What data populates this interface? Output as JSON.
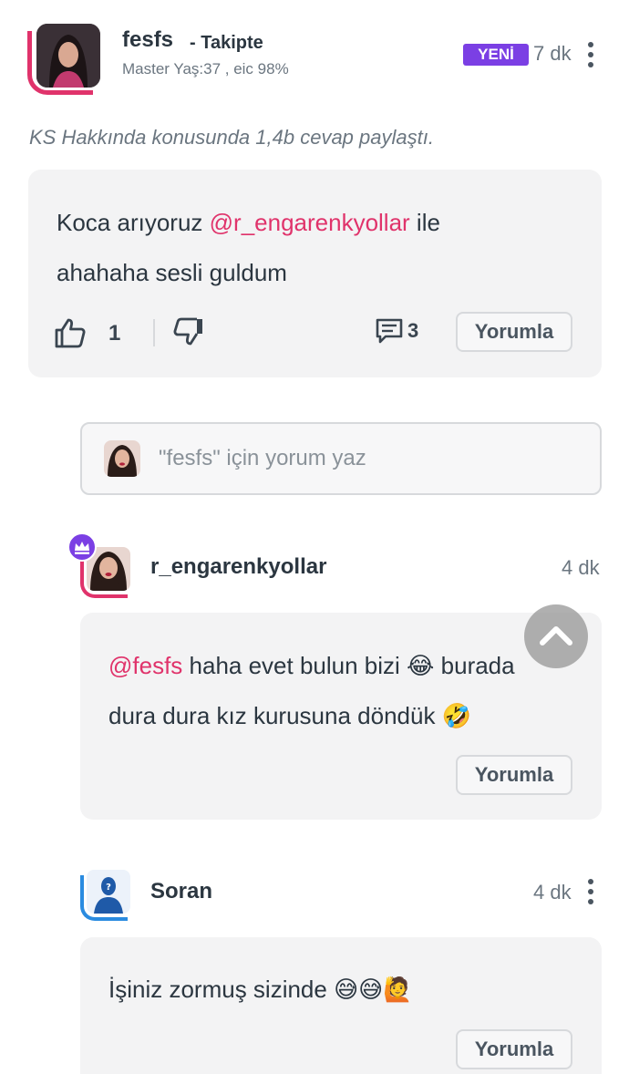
{
  "post": {
    "username": "fesfs",
    "follow_label": "- Takipte",
    "meta": "Master Yaş:37 , eic 98%",
    "badge": "YENİ",
    "time": "7 dk",
    "activity": "KS Hakkında konusunda 1,4b cevap paylaştı.",
    "body_before_mention": "Koca arıyoruz ",
    "mention": "@r_engarenkyollar",
    "body_after_mention": " ile",
    "body_line2": "ahahaha sesli guldum",
    "like_count": "1",
    "comment_count": "3",
    "reply_button": "Yorumla"
  },
  "comment_box": {
    "placeholder": "\"fesfs\" için yorum yaz"
  },
  "replies": [
    {
      "username": "r_engarenkyollar",
      "time": "4 dk",
      "mention": "@fesfs",
      "text_line1": " haha evet bulun bizi 😂 burada",
      "text_line2": "dura dura kız kurusuna döndük 🤣",
      "reply_button": "Yorumla"
    },
    {
      "username": "Soran",
      "time": "4 dk",
      "text_line1": "İşiniz zormuş sizinde 😅😅🙋",
      "reply_button": "Yorumla"
    }
  ],
  "icons": [
    "thumbs-up-icon",
    "thumbs-down-icon",
    "comment-icon",
    "more-vert-icon",
    "crown-icon",
    "chevron-up-icon"
  ],
  "colors": {
    "accent": "#e0336b",
    "badge": "#7b3fe4",
    "ring_blue": "#2a8be0"
  }
}
